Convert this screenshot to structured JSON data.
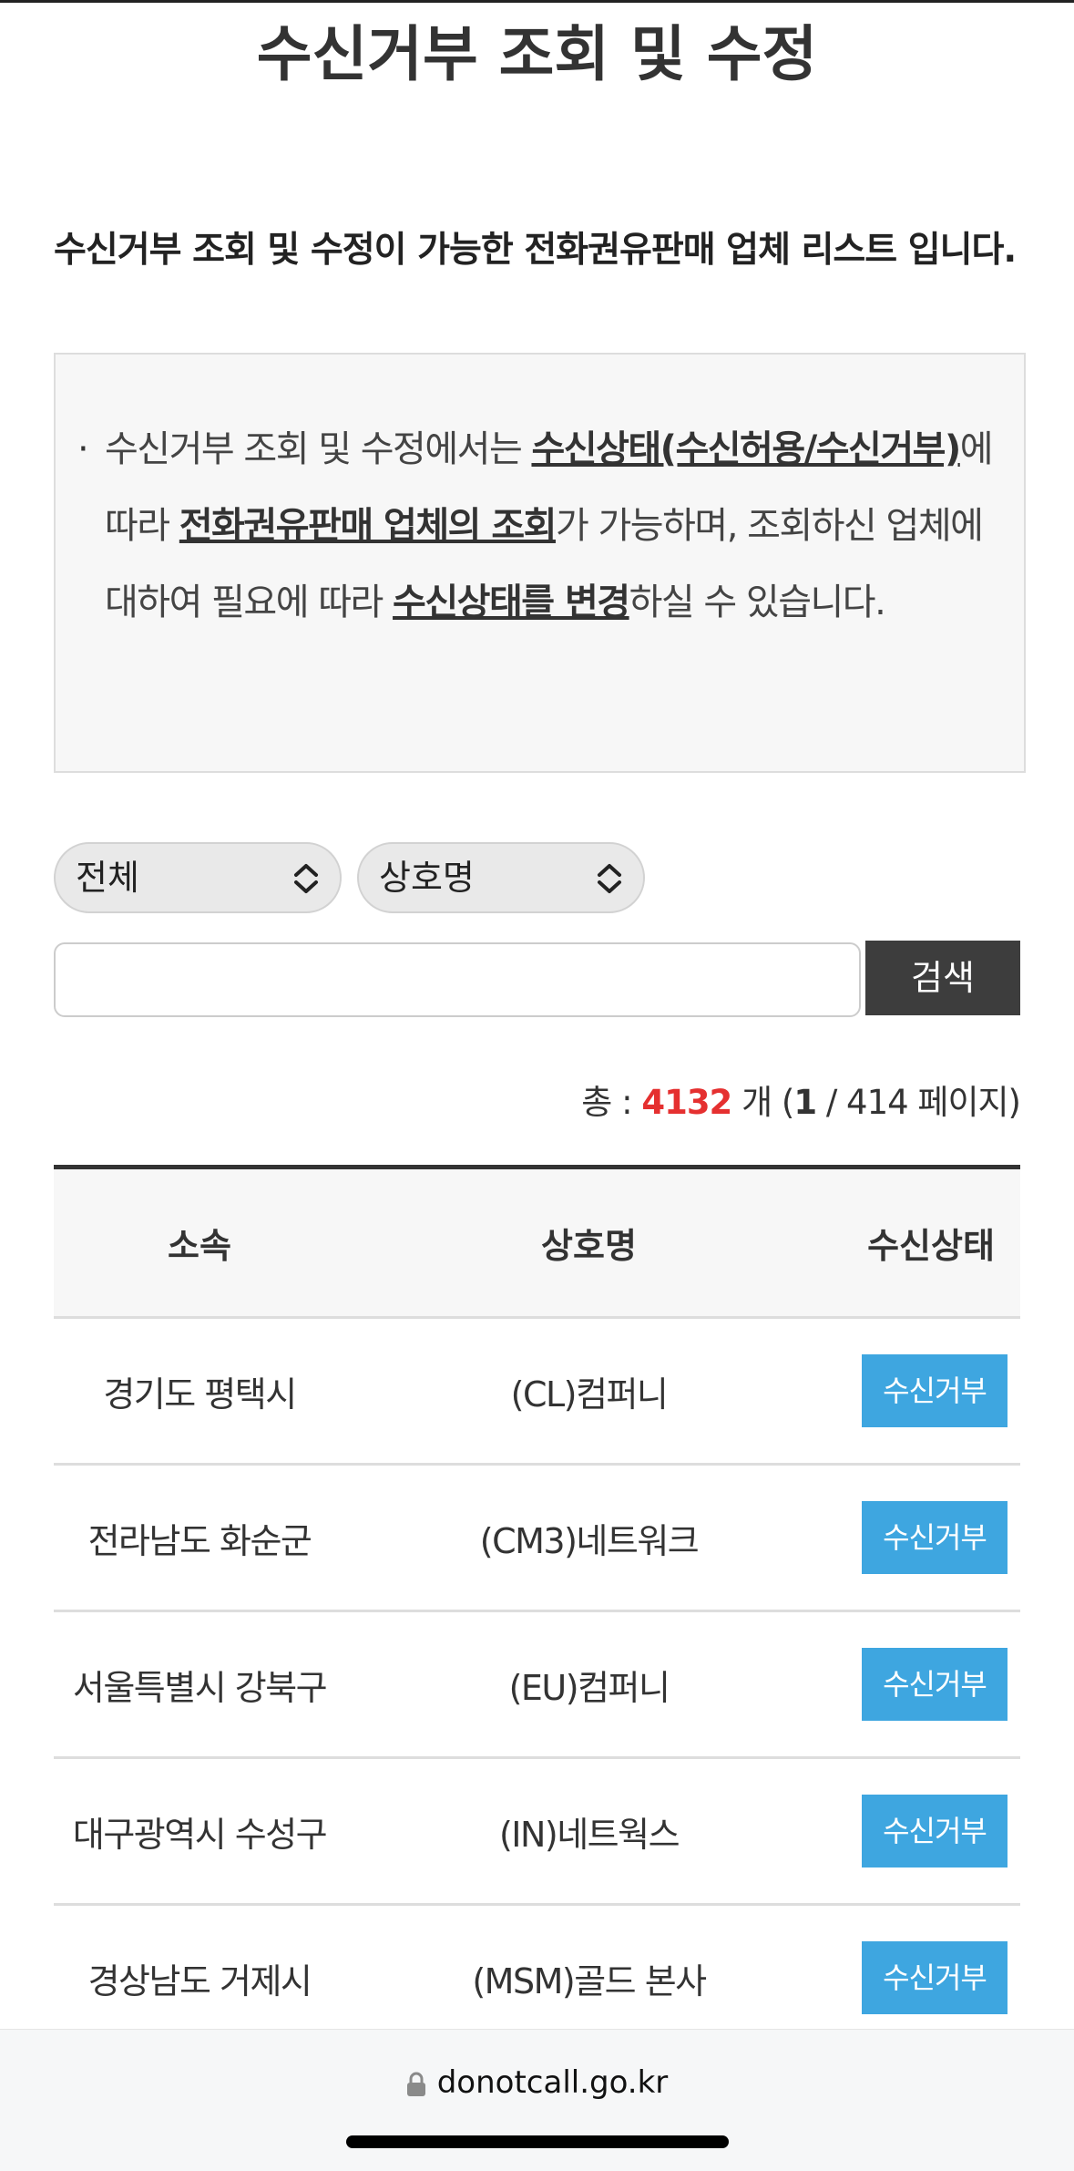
{
  "page": {
    "title": "수신거부 조회 및 수정",
    "subtitle": "수신거부 조회 및 수정이 가능한 전화권유판매 업체 리스트 입니다."
  },
  "notice": {
    "bullet": "·",
    "t1": "수신거부 조회 및 수정에서는 ",
    "s1": "수신상태(수신허용/수신거부)",
    "t2": "에 따라 ",
    "s2": "전화권유판매 업체의 조회",
    "t3": "가 가능하며, 조회하신 업체에 대하여 필요에 따라 ",
    "s3": "수신상태를 변경",
    "t4": "하실 수 있습니다."
  },
  "filters": {
    "region_select": "전체",
    "field_select": "상호명",
    "search_value": "",
    "search_button": "검색"
  },
  "summary": {
    "prefix": "총 : ",
    "total": "4132",
    "mid": " 개 (",
    "current_page": "1",
    "suffix": " / 414 페이지)"
  },
  "table": {
    "headers": [
      "소속",
      "상호명",
      "수신상태"
    ],
    "rows": [
      {
        "region": "경기도 평택시",
        "name": "(CL)컴퍼니",
        "status": "수신거부"
      },
      {
        "region": "전라남도 화순군",
        "name": "(CM3)네트워크",
        "status": "수신거부"
      },
      {
        "region": "서울특별시 강북구",
        "name": "(EU)컴퍼니",
        "status": "수신거부"
      },
      {
        "region": "대구광역시 수성구",
        "name": "(IN)네트웍스",
        "status": "수신거부"
      },
      {
        "region": "경상남도 거제시",
        "name": "(MSM)골드 본사",
        "status": "수신거부"
      }
    ]
  },
  "browser": {
    "url": "donotcall.go.kr",
    "lock_icon": "lock-icon"
  },
  "colors": {
    "accent_total": "#e53030",
    "status_badge": "#3ea6e0",
    "search_button": "#3d3d3d"
  }
}
